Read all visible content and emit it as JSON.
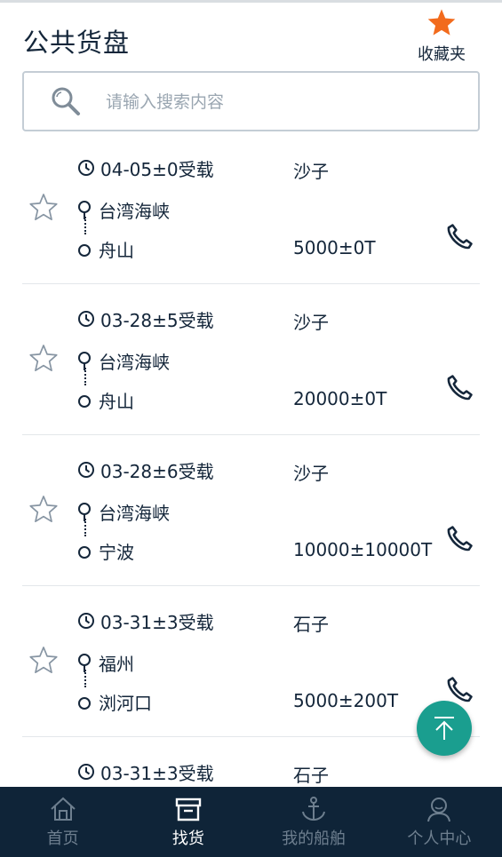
{
  "header": {
    "title": "公共货盘",
    "favorites_label": "收藏夹"
  },
  "search": {
    "placeholder": "请输入搜索内容",
    "value": ""
  },
  "listings": [
    {
      "date": "04-05±0受载",
      "cargo": "沙子",
      "from": "台湾海峡",
      "to": "舟山",
      "weight": "5000±0T"
    },
    {
      "date": "03-28±5受载",
      "cargo": "沙子",
      "from": "台湾海峡",
      "to": "舟山",
      "weight": "20000±0T"
    },
    {
      "date": "03-28±6受载",
      "cargo": "沙子",
      "from": "台湾海峡",
      "to": "宁波",
      "weight": "10000±10000T"
    },
    {
      "date": "03-31±3受载",
      "cargo": "石子",
      "from": "福州",
      "to": "浏河口",
      "weight": "5000±200T"
    },
    {
      "date": "03-31±3受载",
      "cargo": "石子",
      "from": "",
      "to": "",
      "weight": ""
    }
  ],
  "tabbar": [
    {
      "label": "首页",
      "icon": "home-icon",
      "active": false
    },
    {
      "label": "找货",
      "icon": "box-icon",
      "active": true
    },
    {
      "label": "我的船舶",
      "icon": "anchor-icon",
      "active": false
    },
    {
      "label": "个人中心",
      "icon": "person-icon",
      "active": false
    }
  ],
  "colors": {
    "accent_star": "#f26b1d",
    "fab": "#1a9e8f",
    "tabbar_bg": "#0f2438",
    "text": "#14263a"
  }
}
